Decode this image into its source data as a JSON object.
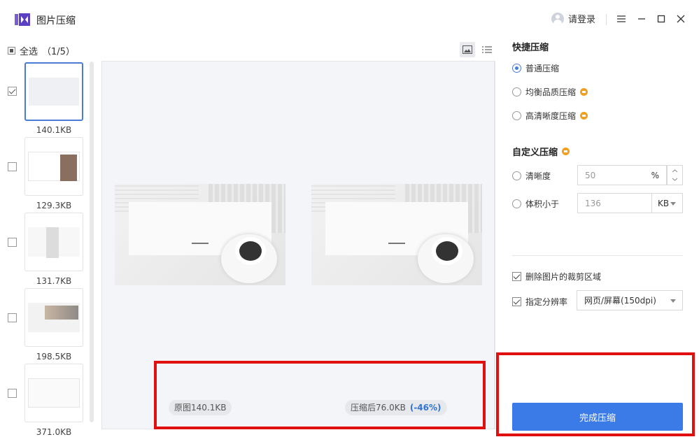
{
  "app": {
    "title": "图片压缩",
    "login": "请登录"
  },
  "left": {
    "select_all": "全选",
    "count": "（1/5）",
    "items": [
      {
        "size": "140.1KB",
        "checked": true
      },
      {
        "size": "129.3KB",
        "checked": false
      },
      {
        "size": "131.7KB",
        "checked": false
      },
      {
        "size": "198.5KB",
        "checked": false
      },
      {
        "size": "371.0KB",
        "checked": false
      }
    ]
  },
  "preview": {
    "original_label": "原图140.1KB",
    "compressed_label": "压缩后76.0KB",
    "percent": "(-46%)"
  },
  "quick": {
    "title": "快捷压缩",
    "options": [
      {
        "label": "普通压缩",
        "selected": true
      },
      {
        "label": "均衡品质压缩",
        "selected": false
      },
      {
        "label": "高清晰度压缩",
        "selected": false
      }
    ]
  },
  "custom": {
    "title": "自定义压缩",
    "clarity_label": "清晰度",
    "clarity_value": "50",
    "clarity_unit": "%",
    "size_label": "体积小于",
    "size_value": "136",
    "size_unit": "KB"
  },
  "settings": {
    "remove_crop": "删除图片的裁剪区域",
    "resolution_label": "指定分辨率",
    "resolution_value": "网页/屏幕(150dpi)"
  },
  "actions": {
    "done": "完成压缩"
  },
  "colors": {
    "accent": "#3b7be8",
    "annotation": "#e01010",
    "vip": "#f0a020"
  }
}
